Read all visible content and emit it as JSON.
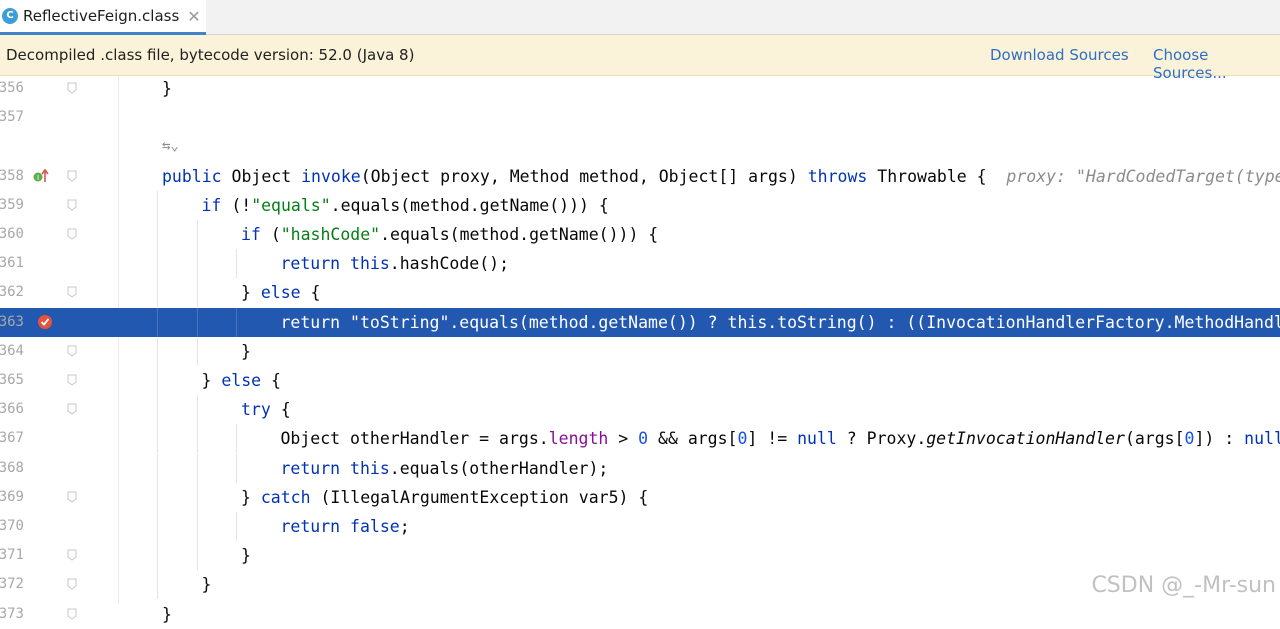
{
  "tab": {
    "title": "ReflectiveFeign.class",
    "icon_letter": "C"
  },
  "banner": {
    "text": "Decompiled .class file, bytecode version: 52.0 (Java 8)",
    "download_sources": "Download Sources",
    "choose_sources": "Choose Sources..."
  },
  "lines": [
    {
      "num": "356",
      "indent": 1,
      "tokens": [
        [
          "}",
          ""
        ]
      ]
    },
    {
      "num": "357",
      "indent": 0,
      "tokens": []
    },
    {
      "num": "",
      "indent": 1,
      "tokens": [],
      "inlay": true
    },
    {
      "num": "358",
      "indent": 1,
      "tokens": [
        [
          "public ",
          "kw"
        ],
        [
          "Object ",
          ""
        ],
        [
          "invoke",
          "kw"
        ],
        [
          "(Object proxy, Method method, Object[] args) ",
          ""
        ],
        [
          "throws ",
          "kw"
        ],
        [
          "Throwable {  ",
          ""
        ],
        [
          "proxy: \"HardCodedTarget(type",
          "hint"
        ]
      ],
      "icon": "implements"
    },
    {
      "num": "359",
      "indent": 2,
      "tokens": [
        [
          "if ",
          "kw"
        ],
        [
          "(!",
          ""
        ],
        [
          "\"equals\"",
          "str"
        ],
        [
          ".equals(method.getName())) {",
          ""
        ]
      ]
    },
    {
      "num": "360",
      "indent": 3,
      "tokens": [
        [
          "if ",
          "kw"
        ],
        [
          "(",
          ""
        ],
        [
          "\"hashCode\"",
          "str"
        ],
        [
          ".equals(method.getName())) {",
          ""
        ]
      ]
    },
    {
      "num": "361",
      "indent": 4,
      "tokens": [
        [
          "return ",
          "kw"
        ],
        [
          "this",
          "kw"
        ],
        [
          ".hashCode();",
          ""
        ]
      ]
    },
    {
      "num": "362",
      "indent": 3,
      "tokens": [
        [
          "} ",
          ""
        ],
        [
          "else ",
          "kw"
        ],
        [
          "{",
          ""
        ]
      ]
    },
    {
      "num": "363",
      "indent": 4,
      "tokens": [
        [
          "return \"toString\".equals(method.getName()) ? this.toString() : ((InvocationHandlerFactory.MethodHandle",
          ""
        ]
      ],
      "highlight": true,
      "icon": "breakpoint"
    },
    {
      "num": "364",
      "indent": 3,
      "tokens": [
        [
          "}",
          ""
        ]
      ]
    },
    {
      "num": "365",
      "indent": 2,
      "tokens": [
        [
          "} ",
          ""
        ],
        [
          "else ",
          "kw"
        ],
        [
          "{",
          ""
        ]
      ]
    },
    {
      "num": "366",
      "indent": 3,
      "tokens": [
        [
          "try ",
          "kw"
        ],
        [
          "{",
          ""
        ]
      ]
    },
    {
      "num": "367",
      "indent": 4,
      "tokens": [
        [
          "Object otherHandler = args.",
          ""
        ],
        [
          "length",
          "fld"
        ],
        [
          " > ",
          ""
        ],
        [
          "0",
          "num"
        ],
        [
          " && args[",
          ""
        ],
        [
          "0",
          "num"
        ],
        [
          "] != ",
          ""
        ],
        [
          "null",
          "kw"
        ],
        [
          " ? Proxy.",
          ""
        ],
        [
          "getInvocationHandler",
          "ita"
        ],
        [
          "(args[",
          ""
        ],
        [
          "0",
          "num"
        ],
        [
          "]) : ",
          ""
        ],
        [
          "null",
          "kw"
        ],
        [
          ";",
          ""
        ]
      ]
    },
    {
      "num": "368",
      "indent": 4,
      "tokens": [
        [
          "return ",
          "kw"
        ],
        [
          "this",
          "kw"
        ],
        [
          ".equals(otherHandler);",
          ""
        ]
      ]
    },
    {
      "num": "369",
      "indent": 3,
      "tokens": [
        [
          "} ",
          ""
        ],
        [
          "catch ",
          "kw"
        ],
        [
          "(IllegalArgumentException var5) {",
          ""
        ]
      ]
    },
    {
      "num": "370",
      "indent": 4,
      "tokens": [
        [
          "return ",
          "kw"
        ],
        [
          "false",
          "kw"
        ],
        [
          ";",
          ""
        ]
      ]
    },
    {
      "num": "371",
      "indent": 3,
      "tokens": [
        [
          "}",
          ""
        ]
      ]
    },
    {
      "num": "372",
      "indent": 2,
      "tokens": [
        [
          "}",
          ""
        ]
      ]
    },
    {
      "num": "373",
      "indent": 1,
      "tokens": [
        [
          "}",
          ""
        ]
      ]
    }
  ],
  "watermark": "CSDN @_-Mr-sun"
}
